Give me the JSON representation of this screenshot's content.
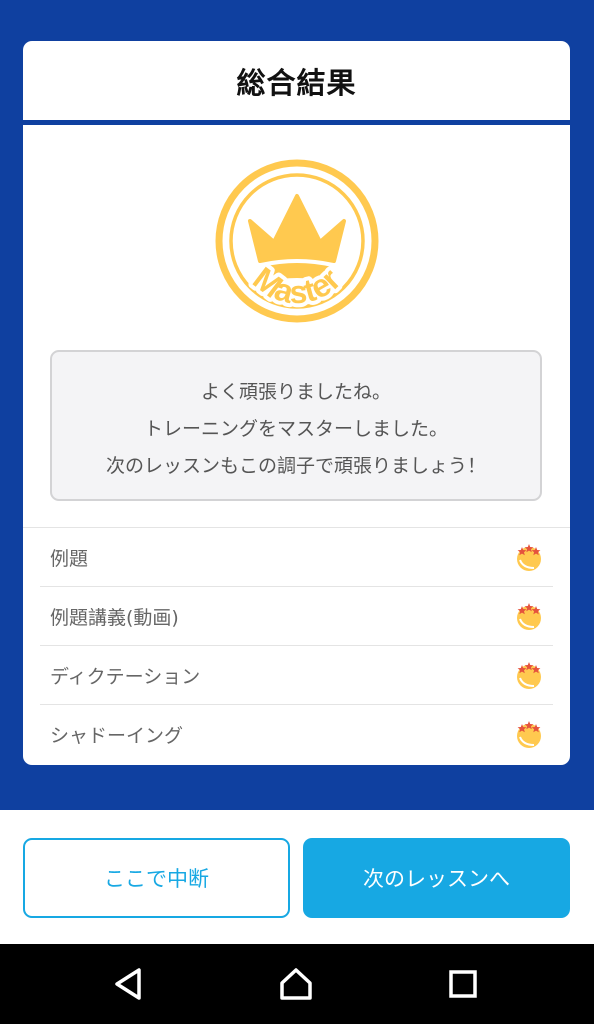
{
  "header": {
    "title": "総合結果"
  },
  "badge": {
    "label": "Master",
    "color": "#ffc94f"
  },
  "message": {
    "lines": [
      "よく頑張りましたね。",
      "トレーニングをマスターしました。",
      "次のレッスンもこの調子で頑張りましょう！"
    ]
  },
  "results": [
    {
      "label": "例題",
      "icon": "gold-medal-icon"
    },
    {
      "label": "例題講義(動画)",
      "icon": "gold-medal-icon"
    },
    {
      "label": "ディクテーション",
      "icon": "gold-medal-icon"
    },
    {
      "label": "シャドーイング",
      "icon": "gold-medal-icon"
    }
  ],
  "actions": {
    "pause_label": "ここで中断",
    "next_label": "次のレッスンへ"
  },
  "navbar": {
    "icons": [
      "back-icon",
      "home-icon",
      "recents-icon"
    ]
  },
  "colors": {
    "primary_blue": "#0f40a0",
    "accent": "#17a8e3",
    "badge": "#ffc94f"
  }
}
